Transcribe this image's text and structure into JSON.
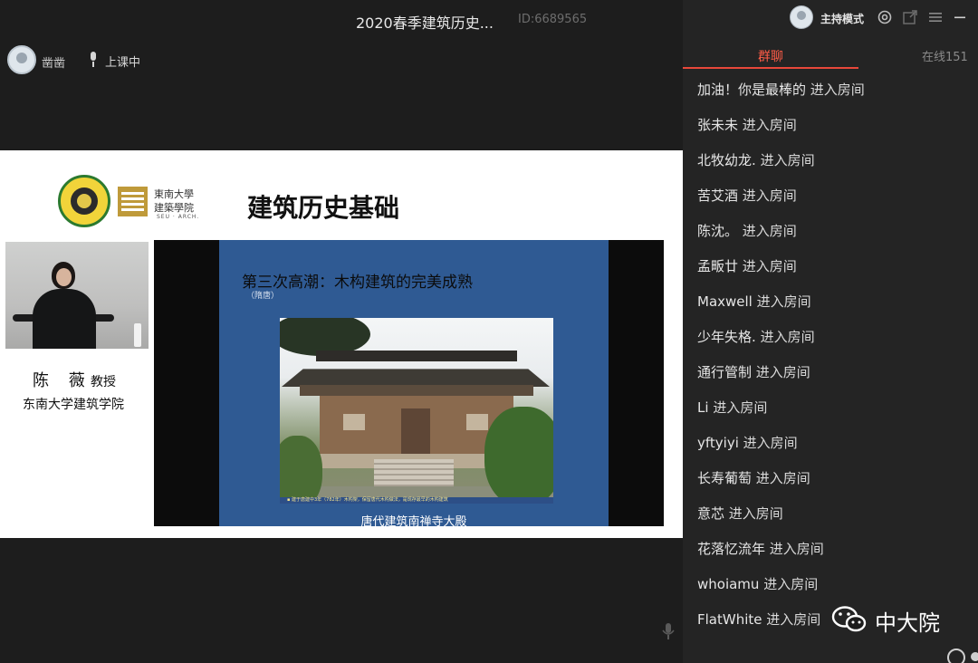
{
  "title_bar": {
    "title": "2020春季建筑历史...",
    "room_id": "ID:6689565"
  },
  "host": {
    "name": "凿凿",
    "status": "上课中"
  },
  "top_controls": {
    "mode_label": "主持模式"
  },
  "chat_tabs": {
    "group_chat": "群聊",
    "online": "在线151"
  },
  "slide": {
    "school_name_line1": "東南大學",
    "school_name_line2": "建築學院",
    "school_abbrev": "SEU · ARCH.",
    "course_title": "建筑历史基础",
    "teacher_name": "陈 薇",
    "teacher_title": "教授",
    "teacher_school": "东南大学建筑学院",
    "ppt": {
      "heading": "第三次高潮：木构建筑的完美成熟",
      "subheading": "（隋唐）",
      "photo_caption_small": "▪ 建于唐建中3年（782年）木构架，保留唐代木构做法，是现存最早的木构建筑",
      "caption": "唐代建筑南禅寺大殿"
    }
  },
  "chat_messages": [
    {
      "user": "加油！你是最棒的",
      "action": "进入房间"
    },
    {
      "user": "张未未",
      "action": "进入房间"
    },
    {
      "user": "北牧幼龙.",
      "action": "进入房间"
    },
    {
      "user": "苦艾酒",
      "action": "进入房间"
    },
    {
      "user": "陈沈。",
      "action": "进入房间"
    },
    {
      "user": "孟畈廿",
      "action": "进入房间"
    },
    {
      "user": "Maxwell",
      "action": "进入房间"
    },
    {
      "user": "少年失格.",
      "action": "进入房间"
    },
    {
      "user": "通行管制",
      "action": "进入房间"
    },
    {
      "user": "Li",
      "action": "进入房间"
    },
    {
      "user": "yftyiyi",
      "action": "进入房间"
    },
    {
      "user": "长寿葡萄",
      "action": "进入房间"
    },
    {
      "user": "意芯",
      "action": "进入房间"
    },
    {
      "user": "花落忆流年",
      "action": "进入房间"
    },
    {
      "user": "whoiamu",
      "action": "进入房间"
    },
    {
      "user": "FlatWhite",
      "action": "进入房间"
    }
  ],
  "watermark": {
    "name": "中大院"
  },
  "colors": {
    "accent": "#e8483a",
    "panel_bg": "#242424",
    "slide_blue": "#2f5a93"
  },
  "icons": [
    "avatar",
    "mic-icon",
    "settings-icon",
    "share-icon",
    "menu-icon",
    "minimize-icon",
    "emoji-icon",
    "wechat-logo"
  ]
}
